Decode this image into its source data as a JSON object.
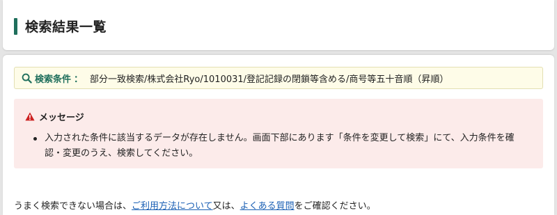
{
  "header": {
    "title": "検索結果一覧"
  },
  "search_condition": {
    "icon": "search-icon",
    "label": "検索条件",
    "separator": "：",
    "value": "部分一致検索/株式会社Ryo/1010031/登記記録の閉鎖等含める/商号等五十音順（昇順）"
  },
  "message": {
    "icon": "warning-icon",
    "title": "メッセージ",
    "items": [
      "入力された条件に該当するデータが存在しません。画面下部にあります「条件を変更して検索」にて、入力条件を確認・変更のうえ、検索してください。"
    ]
  },
  "help": {
    "prefix": "うまく検索できない場合は、",
    "link1": "ご利用方法について",
    "middle": "又は、",
    "link2": "よくある質問",
    "suffix": "をご確認ください。"
  },
  "colors": {
    "accent": "#1f6f5c",
    "condition_bg": "#fefce8",
    "message_bg": "#fcebea",
    "warning": "#cc2020",
    "link": "#1a5fb4"
  }
}
